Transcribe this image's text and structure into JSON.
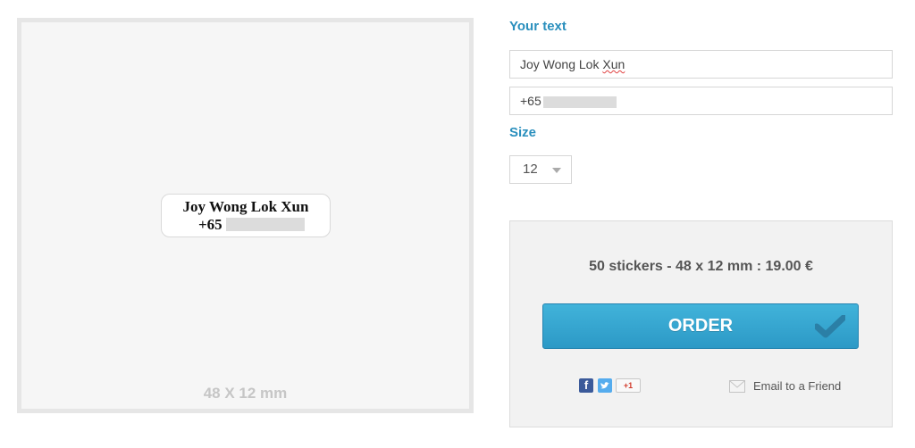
{
  "preview": {
    "sticker_line1": "Joy Wong Lok Xun",
    "sticker_line2": "+65",
    "size_caption": "48 X 12 mm"
  },
  "form": {
    "your_text_label": "Your text",
    "line1_prefix": "Joy Wong Lok ",
    "line1_suffix": "Xun",
    "line2_value": "+65",
    "size_label": "Size",
    "size_value": "12"
  },
  "order": {
    "price": "50 stickers - 48 x 12 mm : 19.00 €",
    "button_label": "ORDER",
    "gplus_label": "+1",
    "email_label": "Email to a Friend"
  },
  "colors": {
    "accent": "#2a8fbd",
    "button": "#35a4d0",
    "check": "#2b7fa6"
  },
  "icons": [
    "check-icon",
    "facebook-icon",
    "twitter-icon",
    "google-plus-icon",
    "envelope-icon",
    "chevron-down-icon"
  ]
}
